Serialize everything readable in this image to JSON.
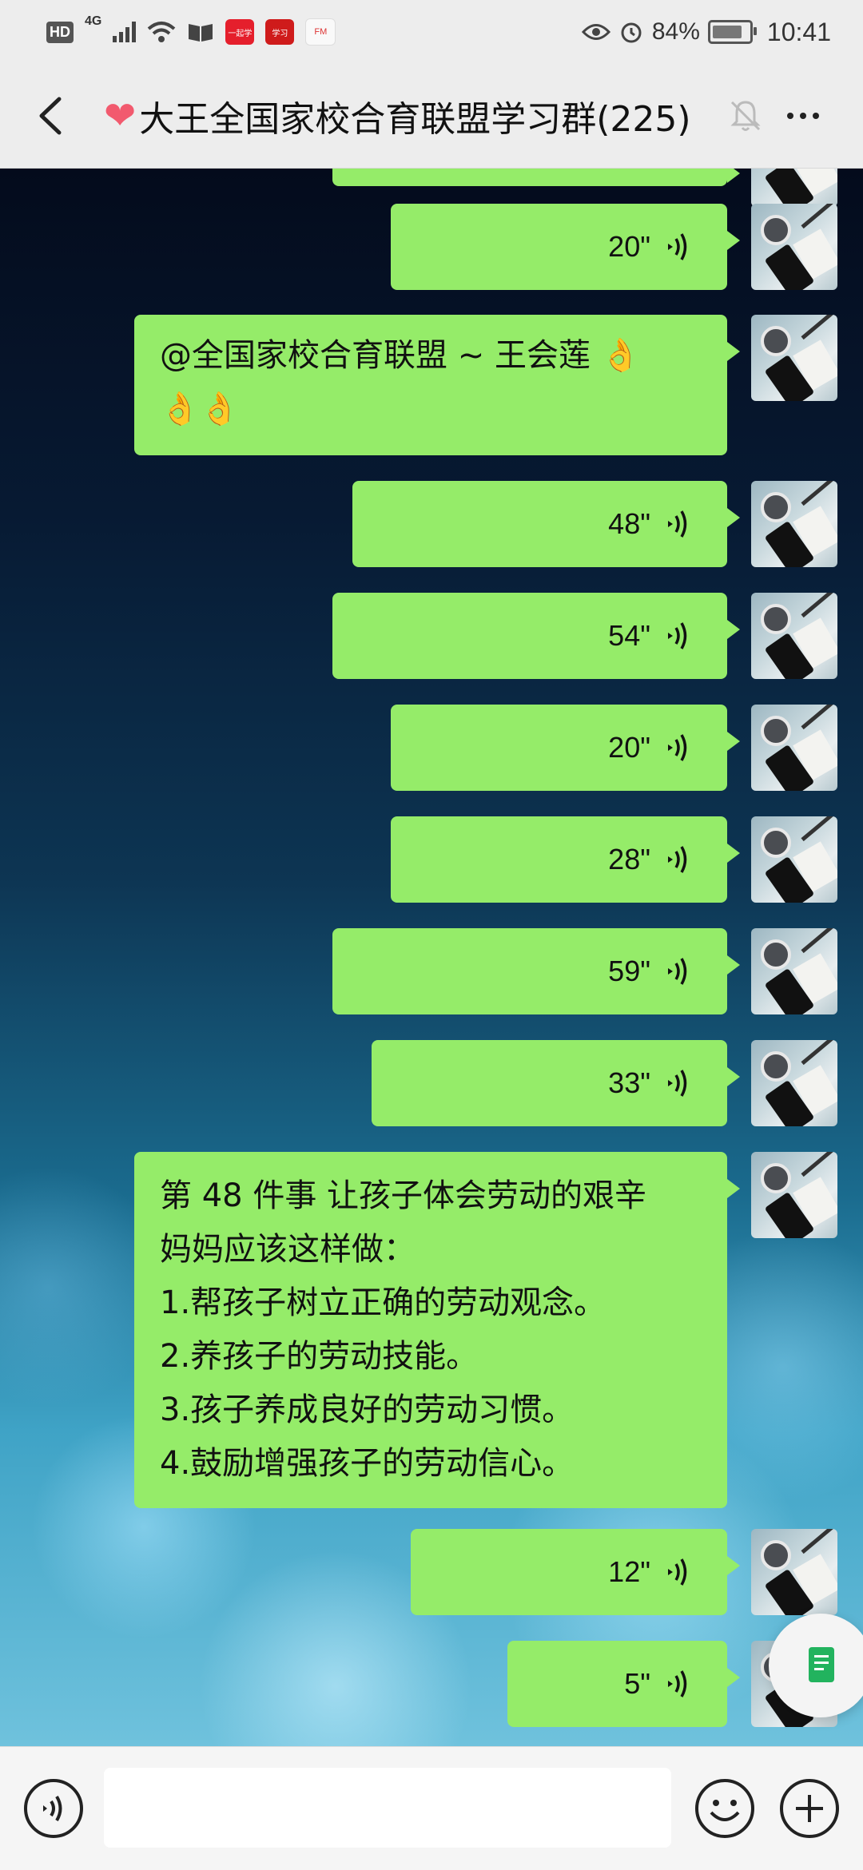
{
  "status_bar": {
    "hd": "HD",
    "network": "4G",
    "battery": "84%",
    "time": "10:41",
    "apps": [
      {
        "name": "一起学",
        "color": "#e51f2c"
      },
      {
        "name": "学习",
        "color": "#cf1b1b"
      },
      {
        "name": "FM",
        "color": "#f9f9f9"
      }
    ]
  },
  "header": {
    "title": "❤️大王全国家校合育联盟学习群(225)",
    "title_text": "大王全国家校合育联盟学习群(225)",
    "heart": "❤"
  },
  "messages": [
    {
      "type": "voice",
      "duration": "20\""
    },
    {
      "type": "text",
      "lines": [
        "@全国家校合育联盟 ~ 王会莲 👌",
        "👌👌"
      ]
    },
    {
      "type": "voice",
      "duration": "48\""
    },
    {
      "type": "voice",
      "duration": "54\""
    },
    {
      "type": "voice",
      "duration": "20\""
    },
    {
      "type": "voice",
      "duration": "28\""
    },
    {
      "type": "voice",
      "duration": "59\""
    },
    {
      "type": "voice",
      "duration": "33\""
    },
    {
      "type": "text",
      "lines": [
        "第 48 件事  让孩子体会劳动的艰辛",
        "妈妈应该这样做：",
        "1.帮孩子树立正确的劳动观念。",
        "2.养孩子的劳动技能。",
        "3.孩子养成良好的劳动习惯。",
        "4.鼓励增强孩子的劳动信心。"
      ]
    },
    {
      "type": "voice",
      "duration": "12\""
    },
    {
      "type": "voice",
      "duration": "5\""
    }
  ],
  "input": {
    "value": "",
    "placeholder": ""
  },
  "colors": {
    "bubble": "#95ec69",
    "bar": "#ededed",
    "accent": "#22b35e"
  }
}
